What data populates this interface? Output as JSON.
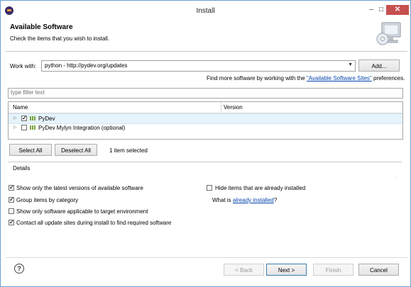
{
  "window": {
    "title": "Install",
    "minimize_glyph": "‒",
    "maximize_glyph": "□",
    "close_glyph": "✕"
  },
  "header": {
    "title": "Available Software",
    "subtitle": "Check the items that you wish to install."
  },
  "work_with": {
    "label": "Work with:",
    "value": "python - http://pydev.org/updates",
    "add_label": "Add..."
  },
  "find_more": {
    "prefix": "Find more software by working with the ",
    "link": "\"Available Software Sites\"",
    "suffix": " preferences."
  },
  "filter": {
    "placeholder": "type filter text"
  },
  "tree": {
    "columns": [
      "Name",
      "Version"
    ],
    "rows": [
      {
        "name": "PyDev",
        "version": "",
        "checked": true,
        "selected": true
      },
      {
        "name": "PyDev Mylyn Integration (optional)",
        "version": "",
        "checked": false,
        "selected": false
      }
    ]
  },
  "selection": {
    "select_all_label": "Select All",
    "deselect_all_label": "Deselect All",
    "status": "1 item selected"
  },
  "details": {
    "label": "Details"
  },
  "options": {
    "show_latest": {
      "label": "Show only the latest versions of available software",
      "checked": true
    },
    "group_by_category": {
      "label": "Group items by category",
      "checked": true
    },
    "show_applicable": {
      "label": "Show only software applicable to target environment",
      "checked": false
    },
    "contact_all": {
      "label": "Contact all update sites during install to find required software",
      "checked": true
    },
    "hide_installed": {
      "label": "Hide items that are already installed",
      "checked": false
    },
    "what_is_prefix": "What is ",
    "what_is_link": "already installed",
    "what_is_suffix": "?"
  },
  "footer": {
    "help_glyph": "?",
    "back_label": "< Back",
    "next_label": "Next >",
    "finish_label": "Finish",
    "cancel_label": "Cancel"
  },
  "colors": {
    "selection_row": "#e5f3fb",
    "close_button": "#c75050",
    "link": "#0645ad",
    "window_border": "#6b9fd1"
  },
  "icons": {
    "app": "eclipse-icon",
    "banner": "monitor-cd-icon",
    "package": "feature-package-icon",
    "help": "help-icon"
  }
}
